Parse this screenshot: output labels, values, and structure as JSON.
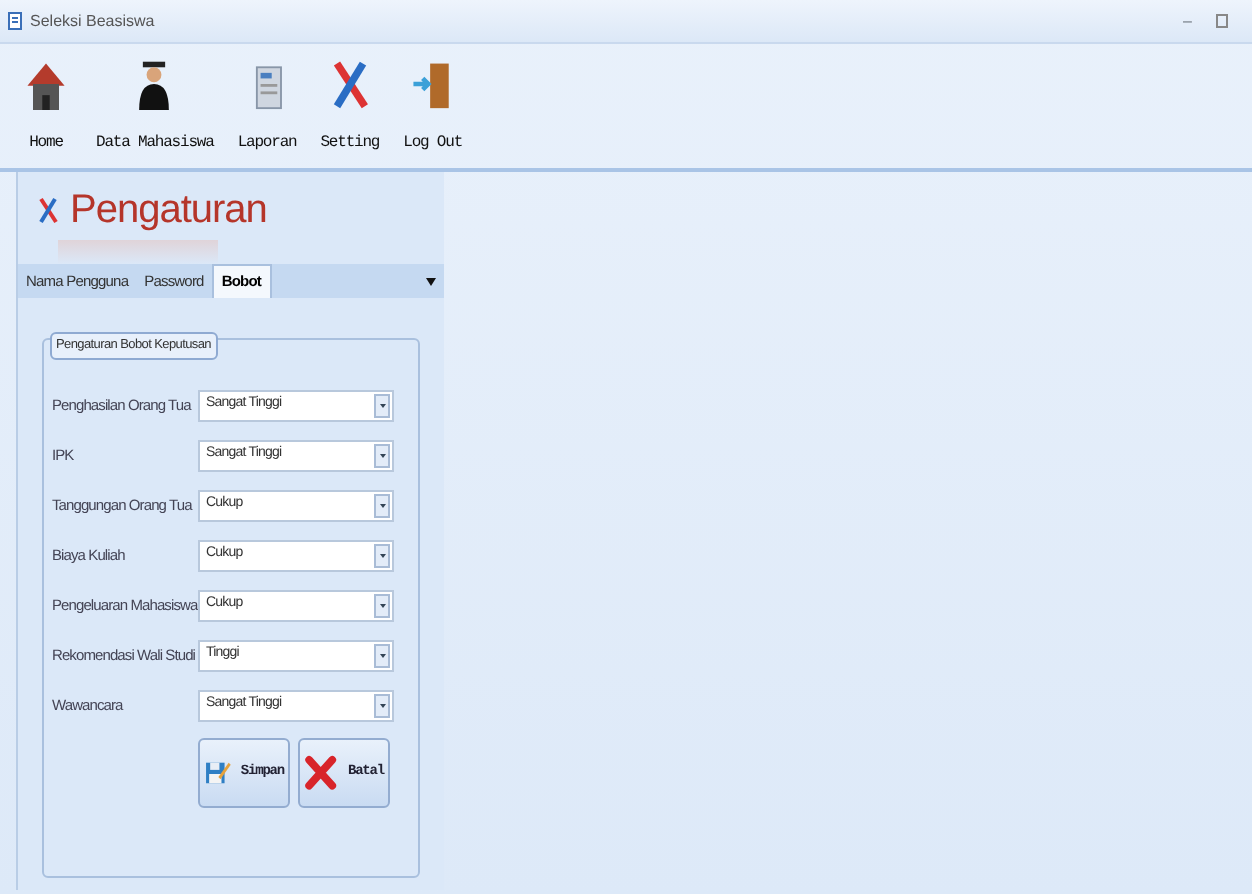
{
  "window": {
    "title": "Seleksi Beasiswa",
    "controls": [
      "–"
    ]
  },
  "toolbar": [
    {
      "label": "Home",
      "kind": "home"
    },
    {
      "label": "Data Mahasiswa",
      "kind": "student"
    },
    {
      "label": "Laporan",
      "kind": "report"
    },
    {
      "label": "Setting",
      "kind": "setting"
    },
    {
      "label": "Log Out",
      "kind": "logout"
    }
  ],
  "page": {
    "title": "Pengaturan"
  },
  "tabs": [
    {
      "label": "Nama Pengguna",
      "selected": false
    },
    {
      "label": "Password",
      "selected": false
    },
    {
      "label": "Bobot",
      "selected": true
    }
  ],
  "group": {
    "legend": "Pengaturan Bobot Keputusan"
  },
  "fields": [
    {
      "label": "Penghasilan Orang Tua",
      "value": "Sangat Tinggi"
    },
    {
      "label": "IPK",
      "value": "Sangat Tinggi"
    },
    {
      "label": "Tanggungan Orang Tua",
      "value": "Cukup"
    },
    {
      "label": "Biaya Kuliah",
      "value": "Cukup"
    },
    {
      "label": "Pengeluaran Mahasiswa",
      "value": "Cukup"
    },
    {
      "label": "Rekomendasi Wali Studi",
      "value": "Tinggi"
    },
    {
      "label": "Wawancara",
      "value": "Sangat Tinggi"
    }
  ],
  "buttons": [
    {
      "label": "Simpan",
      "kind": "save"
    },
    {
      "label": "Batal",
      "kind": "cancel"
    }
  ]
}
